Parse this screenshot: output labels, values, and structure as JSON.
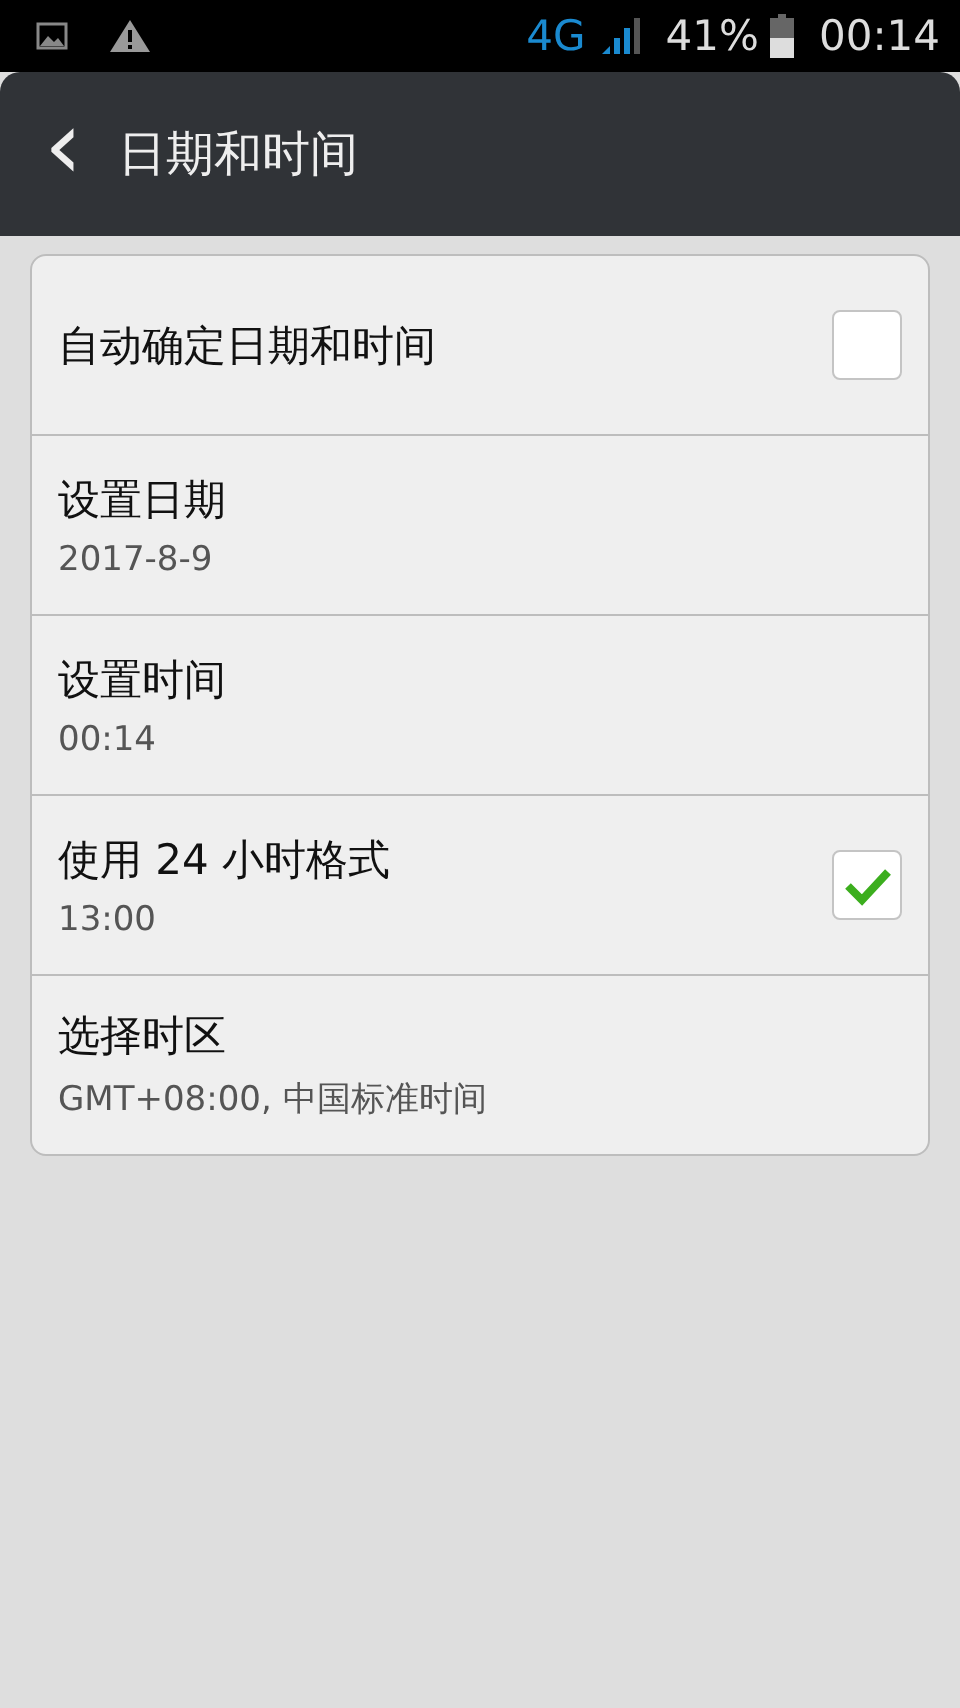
{
  "status_bar": {
    "network": "4G",
    "battery": "41%",
    "time": "00:14"
  },
  "header": {
    "back": "‹",
    "title": "日期和时间"
  },
  "settings": [
    {
      "kind": "checkbox",
      "title": "自动确定日期和时间",
      "checked": false
    },
    {
      "kind": "plain",
      "title": "设置日期",
      "summary": "2017-8-9"
    },
    {
      "kind": "plain",
      "title": "设置时间",
      "summary": "00:14"
    },
    {
      "kind": "checkbox",
      "title": "使用 24 小时格式",
      "summary": "13:00",
      "checked": true
    },
    {
      "kind": "plain",
      "title": "选择时区",
      "summary": "GMT+08:00, 中国标准时间"
    }
  ]
}
